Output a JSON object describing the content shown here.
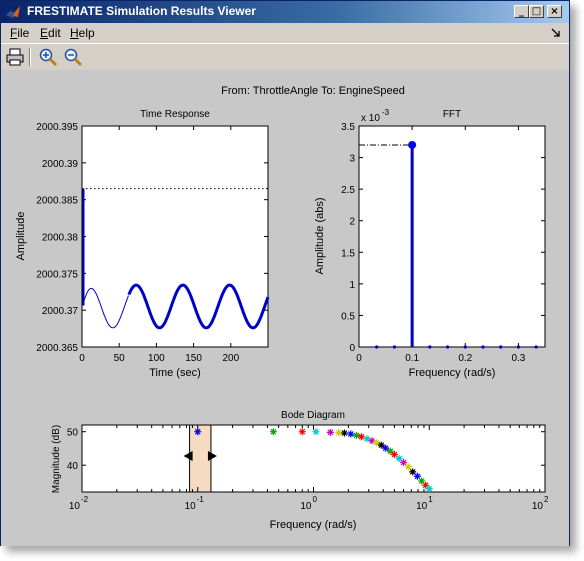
{
  "window": {
    "title": "FRESTIMATE Simulation Results Viewer",
    "title_bar_color": "#0a246a"
  },
  "menu": {
    "items": [
      {
        "label": "File",
        "accel": "F",
        "rest": "ile"
      },
      {
        "label": "Edit",
        "accel": "E",
        "rest": "dit"
      },
      {
        "label": "Help",
        "accel": "H",
        "rest": "elp"
      }
    ]
  },
  "toolbar": {
    "buttons": [
      "printer-icon",
      "zoom-in-icon",
      "zoom-out-icon"
    ]
  },
  "figure": {
    "header": "From: ThrottleAngle  To: EngineSpeed"
  },
  "chart_data": [
    {
      "type": "line",
      "title": "Time Response",
      "xlabel": "Time (sec)",
      "ylabel": "Amplitude",
      "xlim": [
        0,
        250
      ],
      "ylim": [
        2000.365,
        2000.395
      ],
      "xticks": [
        "0",
        "50",
        "100",
        "150",
        "200"
      ],
      "yticks": [
        "2000.365",
        "2000.37",
        "2000.375",
        "2000.38",
        "2000.385",
        "2000.39",
        "2000.395"
      ],
      "dotted_reference_line": 2000.3865,
      "sine_mean": 2000.3705,
      "sine_amplitude": 0.0029,
      "sine_period": 62.8,
      "thick_segment_start": 62.8,
      "initial_spike": 2000.3865,
      "color": "#0000cc"
    },
    {
      "type": "bar",
      "title": "FFT",
      "xlabel": "Frequency (rad/s)",
      "ylabel": "Amplitude (abs)",
      "y_exponent": "x 10",
      "y_exponent_power": "-3",
      "xlim": [
        0,
        0.35
      ],
      "ylim": [
        0,
        3.5
      ],
      "xticks": [
        "0",
        "0.1",
        "0.2",
        "0.3"
      ],
      "yticks": [
        "0",
        "0.5",
        "1",
        "1.5",
        "2",
        "2.5",
        "3",
        "3.5"
      ],
      "peak": {
        "x": 0.1,
        "y": 3.2
      },
      "other_points_x": [
        0.0333,
        0.0667,
        0.1333,
        0.1667,
        0.2,
        0.2333,
        0.2667,
        0.3,
        0.3333
      ],
      "color": "#0000cc"
    },
    {
      "type": "scatter",
      "title": "Bode Diagram",
      "xlabel": "Frequency  (rad/s)",
      "ylabel": "Magnitude (dB)",
      "xscale": "log",
      "xlim": [
        0.01,
        100
      ],
      "ylim": [
        32,
        52
      ],
      "xtick_base": "10",
      "xtick_exponents": [
        "-2",
        "-1",
        "0",
        "1",
        "2"
      ],
      "yticks": [
        "40",
        "50"
      ],
      "selected_point": {
        "x": 0.1,
        "y": 50,
        "color": "#0000ff"
      },
      "selection_band": [
        0.085,
        0.13
      ],
      "selection_band_color": "#f5dcc0",
      "points": [
        {
          "x": 0.45,
          "y": 50,
          "color": "#00aa00"
        },
        {
          "x": 0.8,
          "y": 50,
          "color": "#ff0000"
        },
        {
          "x": 1.05,
          "y": 50,
          "color": "#00cccc"
        },
        {
          "x": 1.4,
          "y": 49.8,
          "color": "#cc00cc"
        },
        {
          "x": 1.65,
          "y": 49.7,
          "color": "#cccc00"
        },
        {
          "x": 1.85,
          "y": 49.6,
          "color": "#000000"
        },
        {
          "x": 2.1,
          "y": 49.3,
          "color": "#0000ff"
        },
        {
          "x": 2.35,
          "y": 48.9,
          "color": "#00aa00"
        },
        {
          "x": 2.6,
          "y": 48.5,
          "color": "#ff0000"
        },
        {
          "x": 2.9,
          "y": 47.9,
          "color": "#00cccc"
        },
        {
          "x": 3.2,
          "y": 47.3,
          "color": "#cc00cc"
        },
        {
          "x": 3.5,
          "y": 46.7,
          "color": "#cccc00"
        },
        {
          "x": 3.85,
          "y": 46.0,
          "color": "#000000"
        },
        {
          "x": 4.2,
          "y": 45.1,
          "color": "#0000ff"
        },
        {
          "x": 4.6,
          "y": 44.2,
          "color": "#00aa00"
        },
        {
          "x": 5.0,
          "y": 43.2,
          "color": "#ff0000"
        },
        {
          "x": 5.5,
          "y": 42.0,
          "color": "#00cccc"
        },
        {
          "x": 6.0,
          "y": 40.8,
          "color": "#cc00cc"
        },
        {
          "x": 6.6,
          "y": 39.5,
          "color": "#cccc00"
        },
        {
          "x": 7.2,
          "y": 38.0,
          "color": "#000000"
        },
        {
          "x": 7.9,
          "y": 36.7,
          "color": "#0000ff"
        },
        {
          "x": 8.6,
          "y": 35.3,
          "color": "#00aa00"
        },
        {
          "x": 9.3,
          "y": 34.0,
          "color": "#ff0000"
        },
        {
          "x": 10.0,
          "y": 33.0,
          "color": "#00cccc"
        }
      ]
    }
  ]
}
